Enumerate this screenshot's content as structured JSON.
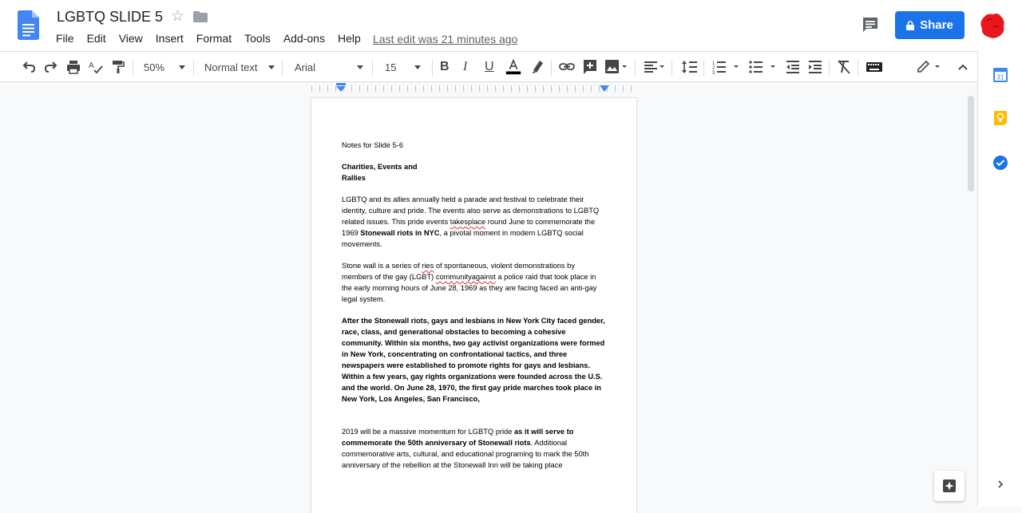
{
  "header": {
    "title": "LGBTQ SLIDE 5",
    "menu": [
      "File",
      "Edit",
      "View",
      "Insert",
      "Format",
      "Tools",
      "Add-ons",
      "Help"
    ],
    "last_edit": "Last edit was 21 minutes ago",
    "share_label": "Share",
    "brand_color": "#1a73e8"
  },
  "toolbar": {
    "zoom": "50%",
    "style": "Normal text",
    "font": "Arial",
    "font_size": "15"
  },
  "document": {
    "heading_note": "Notes for Slide 5-6",
    "section_title_line1": "Charities, Events and",
    "section_title_line2": "Rallies",
    "p1_a": "LGBTQ and its allies annually held a parade and festival to celebrate their identity, culture and pride. The events also serve as demonstrations to LGBTQ related issues. This pride events ",
    "p1_misspelled": "takesplace",
    "p1_b": " round June to commemorate the 1969 ",
    "p1_bold": "Stonewall riots in NYC",
    "p1_c": ", a pivotal moment in modern LGBTQ social movements.",
    "p2_a": "Stone wall is a series of ",
    "p2_misspelled1": "ries",
    "p2_b": " of spontaneous, violent demonstrations by members of the gay (LGBT) ",
    "p2_misspelled2": "communityagainst",
    "p2_c": " a police raid that took place in the early morning hours of June 28, 1969 as they are facing faced an anti-gay legal system.",
    "p3": "After the Stonewall riots, gays and lesbians in New York City faced gender, race, class, and generational obstacles to becoming a cohesive community. Within six months, two gay activist organizations were formed in New York, concentrating on confrontational tactics, and three newspapers were established to promote rights for gays and lesbians. Within a few years, gay rights organizations were founded across the U.S. and the world. On June 28, 1970, the first gay pride marches took place in New York, Los Angeles, San Francisco,",
    "p4_a": "2019 will be a massive momentum for LGBTQ pride ",
    "p4_bold": "as it will serve to commemorate the 50th anniversary of Stonewall riots",
    "p4_b": ". Additional commemorative arts, cultural, and educational programing to mark the 50th anniversary of the rebellion at the Stonewall Inn will be taking place"
  },
  "icons": {
    "undo": "undo-icon",
    "redo": "redo-icon",
    "print": "print-icon",
    "spellcheck": "spellcheck-icon",
    "paint_format": "paint-format-icon",
    "bold": "bold-icon",
    "italic": "italic-icon",
    "underline": "underline-icon",
    "text_color": "text-color-icon",
    "highlight": "highlight-icon",
    "link": "link-icon",
    "comment": "add-comment-icon",
    "image": "image-icon",
    "align": "align-left-icon",
    "line_spacing": "line-spacing-icon",
    "numbered_list": "numbered-list-icon",
    "bulleted_list": "bulleted-list-icon",
    "indent_less": "decrease-indent-icon",
    "indent_more": "increase-indent-icon",
    "clear_format": "clear-formatting-icon",
    "input_tools": "keyboard-icon",
    "editing_mode": "pencil-icon"
  },
  "side_panel": {
    "calendar_day": "31"
  }
}
